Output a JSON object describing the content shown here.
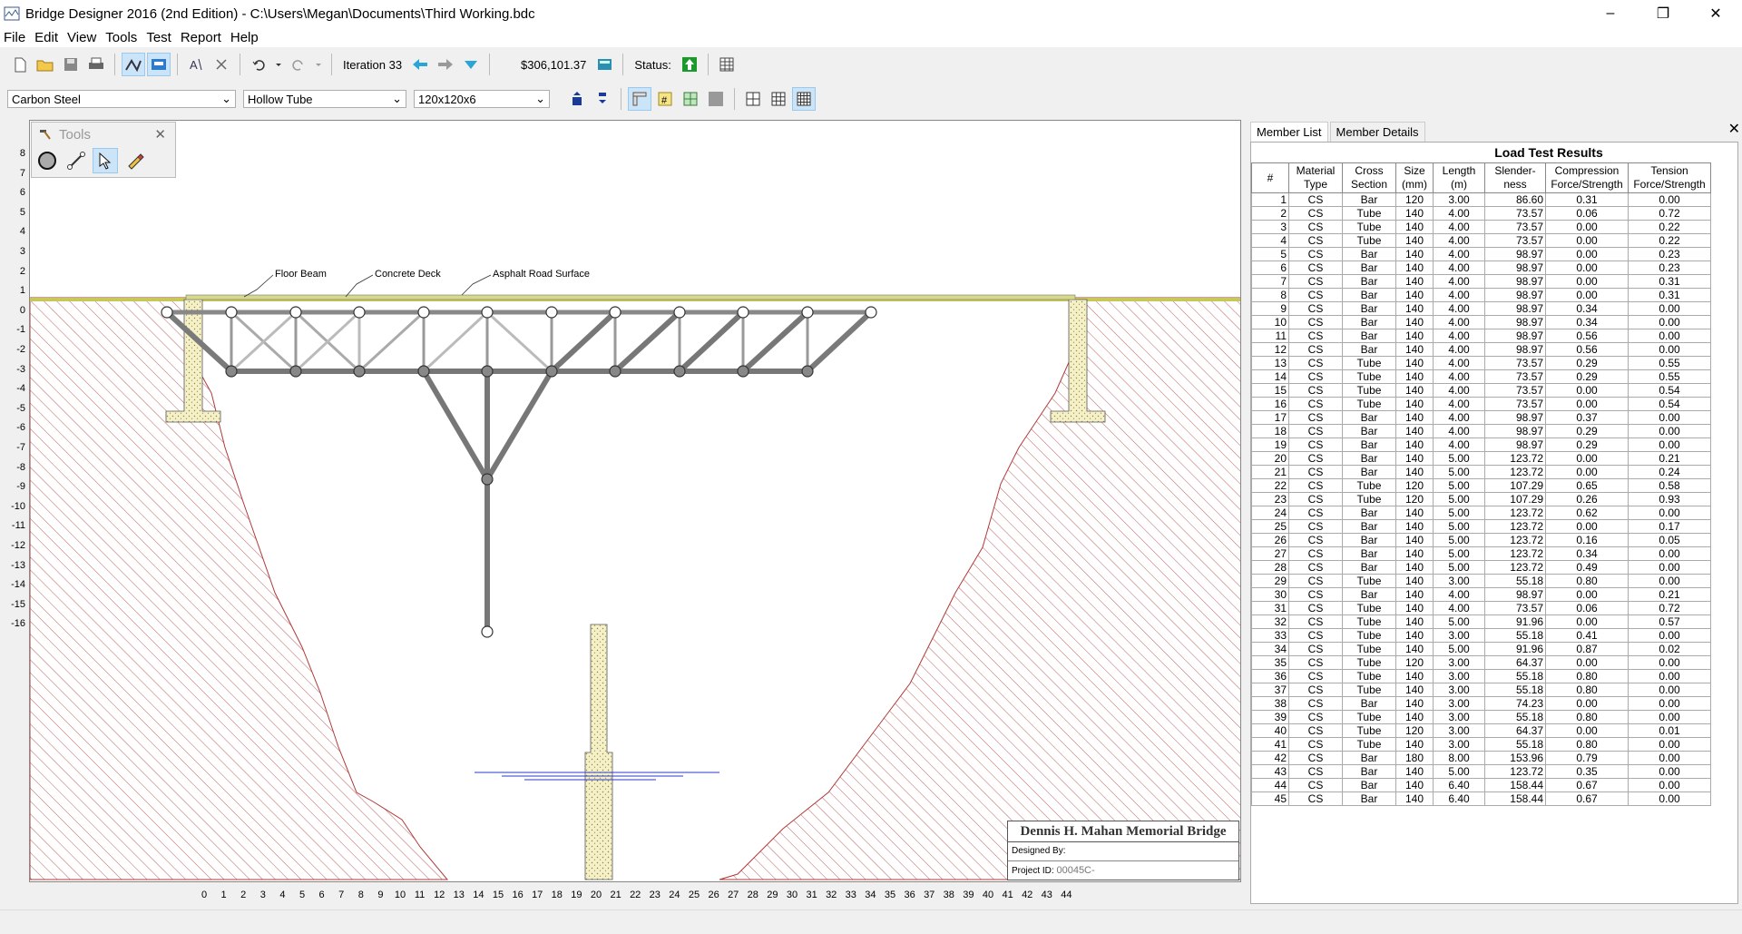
{
  "window": {
    "title": "Bridge Designer 2016 (2nd Edition) - C:\\Users\\Megan\\Documents\\Third Working.bdc"
  },
  "menu": [
    "File",
    "Edit",
    "View",
    "Tools",
    "Test",
    "Report",
    "Help"
  ],
  "toolbar": {
    "iteration": "Iteration 33",
    "cost": "$306,101.37",
    "status_label": "Status:"
  },
  "selectors": {
    "material": "Carbon Steel",
    "section": "Hollow Tube",
    "size": "120x120x6"
  },
  "tools_palette": {
    "title": "Tools"
  },
  "drawing": {
    "labels": {
      "floor_beam": "Floor Beam",
      "concrete_deck": "Concrete Deck",
      "asphalt": "Asphalt Road Surface"
    },
    "y_ticks": [
      "8",
      "7",
      "6",
      "5",
      "4",
      "3",
      "2",
      "1",
      "0",
      "-1",
      "-2",
      "-3",
      "-4",
      "-5",
      "-6",
      "-7",
      "-8",
      "-9",
      "-10",
      "-11",
      "-12",
      "-13",
      "-14",
      "-15",
      "-16"
    ],
    "x_ticks": [
      "0",
      "1",
      "2",
      "3",
      "4",
      "5",
      "6",
      "7",
      "8",
      "9",
      "10",
      "11",
      "12",
      "13",
      "14",
      "15",
      "16",
      "17",
      "18",
      "19",
      "20",
      "21",
      "22",
      "23",
      "24",
      "25",
      "26",
      "27",
      "28",
      "29",
      "30",
      "31",
      "32",
      "33",
      "34",
      "35",
      "36",
      "37",
      "38",
      "39",
      "40",
      "41",
      "42",
      "43",
      "44"
    ],
    "title_block": {
      "name": "Dennis H. Mahan Memorial Bridge",
      "designed_by": "Designed By:",
      "project_id_label": "Project ID:",
      "project_id": "00045C-"
    }
  },
  "panel": {
    "tabs": [
      "Member List",
      "Member Details"
    ],
    "heading": "Load Test Results",
    "headers": [
      "#",
      "Material Type",
      "Cross Section",
      "Size (mm)",
      "Length (m)",
      "Slender- ness",
      "Compression Force/Strength",
      "Tension Force/Strength"
    ],
    "rows": [
      [
        "1",
        "CS",
        "Bar",
        "120",
        "3.00",
        "86.60",
        "0.31",
        "0.00"
      ],
      [
        "2",
        "CS",
        "Tube",
        "140",
        "4.00",
        "73.57",
        "0.06",
        "0.72"
      ],
      [
        "3",
        "CS",
        "Tube",
        "140",
        "4.00",
        "73.57",
        "0.00",
        "0.22"
      ],
      [
        "4",
        "CS",
        "Tube",
        "140",
        "4.00",
        "73.57",
        "0.00",
        "0.22"
      ],
      [
        "5",
        "CS",
        "Bar",
        "140",
        "4.00",
        "98.97",
        "0.00",
        "0.23"
      ],
      [
        "6",
        "CS",
        "Bar",
        "140",
        "4.00",
        "98.97",
        "0.00",
        "0.23"
      ],
      [
        "7",
        "CS",
        "Bar",
        "140",
        "4.00",
        "98.97",
        "0.00",
        "0.31"
      ],
      [
        "8",
        "CS",
        "Bar",
        "140",
        "4.00",
        "98.97",
        "0.00",
        "0.31"
      ],
      [
        "9",
        "CS",
        "Bar",
        "140",
        "4.00",
        "98.97",
        "0.34",
        "0.00"
      ],
      [
        "10",
        "CS",
        "Bar",
        "140",
        "4.00",
        "98.97",
        "0.34",
        "0.00"
      ],
      [
        "11",
        "CS",
        "Bar",
        "140",
        "4.00",
        "98.97",
        "0.56",
        "0.00"
      ],
      [
        "12",
        "CS",
        "Bar",
        "140",
        "4.00",
        "98.97",
        "0.56",
        "0.00"
      ],
      [
        "13",
        "CS",
        "Tube",
        "140",
        "4.00",
        "73.57",
        "0.29",
        "0.55"
      ],
      [
        "14",
        "CS",
        "Tube",
        "140",
        "4.00",
        "73.57",
        "0.29",
        "0.55"
      ],
      [
        "15",
        "CS",
        "Tube",
        "140",
        "4.00",
        "73.57",
        "0.00",
        "0.54"
      ],
      [
        "16",
        "CS",
        "Tube",
        "140",
        "4.00",
        "73.57",
        "0.00",
        "0.54"
      ],
      [
        "17",
        "CS",
        "Bar",
        "140",
        "4.00",
        "98.97",
        "0.37",
        "0.00"
      ],
      [
        "18",
        "CS",
        "Bar",
        "140",
        "4.00",
        "98.97",
        "0.29",
        "0.00"
      ],
      [
        "19",
        "CS",
        "Bar",
        "140",
        "4.00",
        "98.97",
        "0.29",
        "0.00"
      ],
      [
        "20",
        "CS",
        "Bar",
        "140",
        "5.00",
        "123.72",
        "0.00",
        "0.21"
      ],
      [
        "21",
        "CS",
        "Bar",
        "140",
        "5.00",
        "123.72",
        "0.00",
        "0.24"
      ],
      [
        "22",
        "CS",
        "Tube",
        "120",
        "5.00",
        "107.29",
        "0.65",
        "0.58"
      ],
      [
        "23",
        "CS",
        "Tube",
        "120",
        "5.00",
        "107.29",
        "0.26",
        "0.93"
      ],
      [
        "24",
        "CS",
        "Bar",
        "140",
        "5.00",
        "123.72",
        "0.62",
        "0.00"
      ],
      [
        "25",
        "CS",
        "Bar",
        "140",
        "5.00",
        "123.72",
        "0.00",
        "0.17"
      ],
      [
        "26",
        "CS",
        "Bar",
        "140",
        "5.00",
        "123.72",
        "0.16",
        "0.05"
      ],
      [
        "27",
        "CS",
        "Bar",
        "140",
        "5.00",
        "123.72",
        "0.34",
        "0.00"
      ],
      [
        "28",
        "CS",
        "Bar",
        "140",
        "5.00",
        "123.72",
        "0.49",
        "0.00"
      ],
      [
        "29",
        "CS",
        "Tube",
        "140",
        "3.00",
        "55.18",
        "0.80",
        "0.00"
      ],
      [
        "30",
        "CS",
        "Bar",
        "140",
        "4.00",
        "98.97",
        "0.00",
        "0.21"
      ],
      [
        "31",
        "CS",
        "Tube",
        "140",
        "4.00",
        "73.57",
        "0.06",
        "0.72"
      ],
      [
        "32",
        "CS",
        "Tube",
        "140",
        "5.00",
        "91.96",
        "0.00",
        "0.57"
      ],
      [
        "33",
        "CS",
        "Tube",
        "140",
        "3.00",
        "55.18",
        "0.41",
        "0.00"
      ],
      [
        "34",
        "CS",
        "Tube",
        "140",
        "5.00",
        "91.96",
        "0.87",
        "0.02"
      ],
      [
        "35",
        "CS",
        "Tube",
        "120",
        "3.00",
        "64.37",
        "0.00",
        "0.00"
      ],
      [
        "36",
        "CS",
        "Tube",
        "140",
        "3.00",
        "55.18",
        "0.80",
        "0.00"
      ],
      [
        "37",
        "CS",
        "Tube",
        "140",
        "3.00",
        "55.18",
        "0.80",
        "0.00"
      ],
      [
        "38",
        "CS",
        "Bar",
        "140",
        "3.00",
        "74.23",
        "0.00",
        "0.00"
      ],
      [
        "39",
        "CS",
        "Tube",
        "140",
        "3.00",
        "55.18",
        "0.80",
        "0.00"
      ],
      [
        "40",
        "CS",
        "Tube",
        "120",
        "3.00",
        "64.37",
        "0.00",
        "0.01"
      ],
      [
        "41",
        "CS",
        "Tube",
        "140",
        "3.00",
        "55.18",
        "0.80",
        "0.00"
      ],
      [
        "42",
        "CS",
        "Bar",
        "180",
        "8.00",
        "153.96",
        "0.79",
        "0.00"
      ],
      [
        "43",
        "CS",
        "Bar",
        "140",
        "5.00",
        "123.72",
        "0.35",
        "0.00"
      ],
      [
        "44",
        "CS",
        "Bar",
        "140",
        "6.40",
        "158.44",
        "0.67",
        "0.00"
      ],
      [
        "45",
        "CS",
        "Bar",
        "140",
        "6.40",
        "158.44",
        "0.67",
        "0.00"
      ]
    ]
  }
}
